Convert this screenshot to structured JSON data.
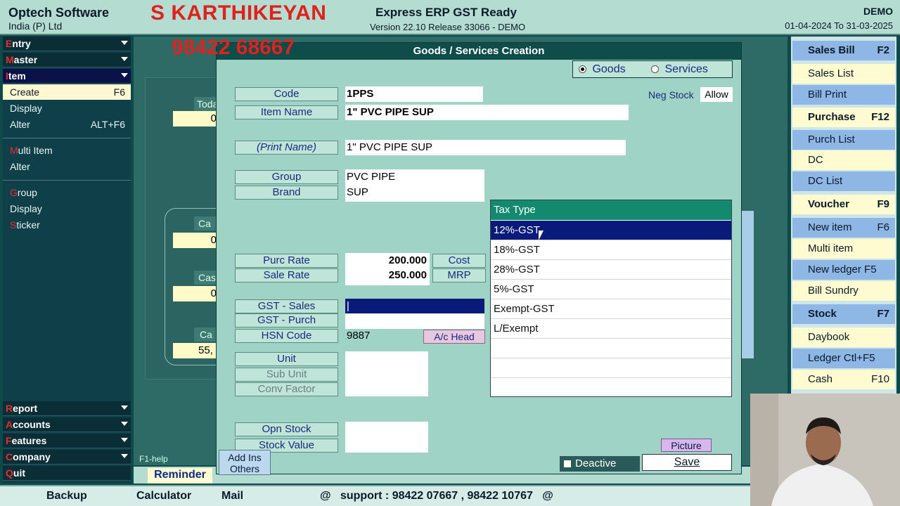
{
  "header": {
    "company_line1": "Optech Software",
    "company_line2": "India (P) Ltd",
    "overlay_name": "S KARTHIKEYAN",
    "overlay_phone": "98422 68667",
    "product": "Express ERP GST Ready",
    "version": "Version 22.10 Release 33066 - DEMO",
    "mode": "DEMO",
    "period": "01-04-2024 To 31-03-2025"
  },
  "left_menu": {
    "entry": {
      "first": "E",
      "rest": "ntry"
    },
    "master": {
      "first": "M",
      "rest": "aster"
    },
    "item": {
      "first": "I",
      "rest": "tem"
    },
    "create": "Create",
    "create_key": "F6",
    "display": "Display",
    "alter": "Alter",
    "alter_key": "ALT+F6",
    "multi_item": {
      "first": "M",
      "rest": "ulti Item"
    },
    "multi_alter": "Alter",
    "group": {
      "first": "G",
      "rest": "roup"
    },
    "group_display": "Display",
    "sticker": {
      "first": "S",
      "rest": "ticker"
    },
    "report": {
      "first": "R",
      "rest": "eport"
    },
    "accounts": {
      "first": "A",
      "rest": "ccounts"
    },
    "features": {
      "first": "F",
      "rest": "eatures"
    },
    "company": {
      "first": "C",
      "rest": "ompany"
    },
    "quit": {
      "first": "Q",
      "rest": "uit"
    }
  },
  "background": {
    "today": "Toda",
    "today_val": "0",
    "cash1": "Ca",
    "cash1_val": "0",
    "cash2": "Cas",
    "cash2_val": "0",
    "cash3": "Ca",
    "cash3_val": "55,",
    "f1help": "F1-help",
    "reminder": "Reminder"
  },
  "dialog": {
    "title": "Goods / Services Creation",
    "type_goods": "Goods",
    "type_services": "Services",
    "neg_stock_label": "Neg Stock",
    "neg_stock_value": "Allow",
    "code_label": "Code",
    "code_value": "1PPS",
    "item_name_label": "Item Name",
    "item_name_value": "1\" PVC PIPE SUP",
    "print_name_label": "(Print Name)",
    "print_name_value": "1\" PVC PIPE SUP",
    "group_label": "Group",
    "group_value": "PVC PIPE",
    "brand_label": "Brand",
    "brand_value": "SUP",
    "purc_rate_label": "Purc Rate",
    "purc_rate_value": "200.000",
    "sale_rate_label": "Sale Rate",
    "sale_rate_value": "250.000",
    "cost_label": "Cost",
    "mrp_label": "MRP",
    "gst_sales_label": "GST - Sales",
    "gst_sales_value": "|",
    "gst_purch_label": "GST - Purch",
    "hsn_label": "HSN Code",
    "hsn_value": "9887",
    "ac_head_button": "A/c Head",
    "unit_label": "Unit",
    "sub_unit_label": "Sub Unit",
    "conv_factor_label": "Conv Factor",
    "opn_stock_label": "Opn Stock",
    "stock_value_label": "Stock Value",
    "add_ins_line1": "Add Ins",
    "add_ins_line2": "Others",
    "picture_button": "Picture",
    "deactive_label": "Deactive",
    "save_button": "Save"
  },
  "tax_type": {
    "header": "Tax Type",
    "options": [
      "12%-GST",
      "18%-GST",
      "28%-GST",
      "5%-GST",
      "Exempt-GST",
      "L/Exempt"
    ],
    "selected": "12%-GST"
  },
  "right_panel": {
    "sales_bill": "Sales Bill",
    "sales_bill_key": "F2",
    "sales_list": "Sales List",
    "bill_print": "Bill Print",
    "purchase": "Purchase",
    "purchase_key": "F12",
    "purch_list": "Purch List",
    "dc": "DC",
    "dc_list": "DC List",
    "voucher": "Voucher",
    "voucher_key": "F9",
    "new_item": "New item",
    "new_item_key": "F6",
    "multi_item": "Multi item",
    "new_ledger": "New ledger F5",
    "bill_sundry": "Bill Sundry",
    "stock": "Stock",
    "stock_key": "F7",
    "daybook": "Daybook",
    "ledger": "Ledger  Ctl+F5",
    "cash": "Cash",
    "cash_key": "F10"
  },
  "bottom_bar": {
    "backup": "Backup",
    "calculator": "Calculator",
    "mail": "Mail",
    "support": "@   support : 98422 07667 , 98422 10767   @"
  }
}
